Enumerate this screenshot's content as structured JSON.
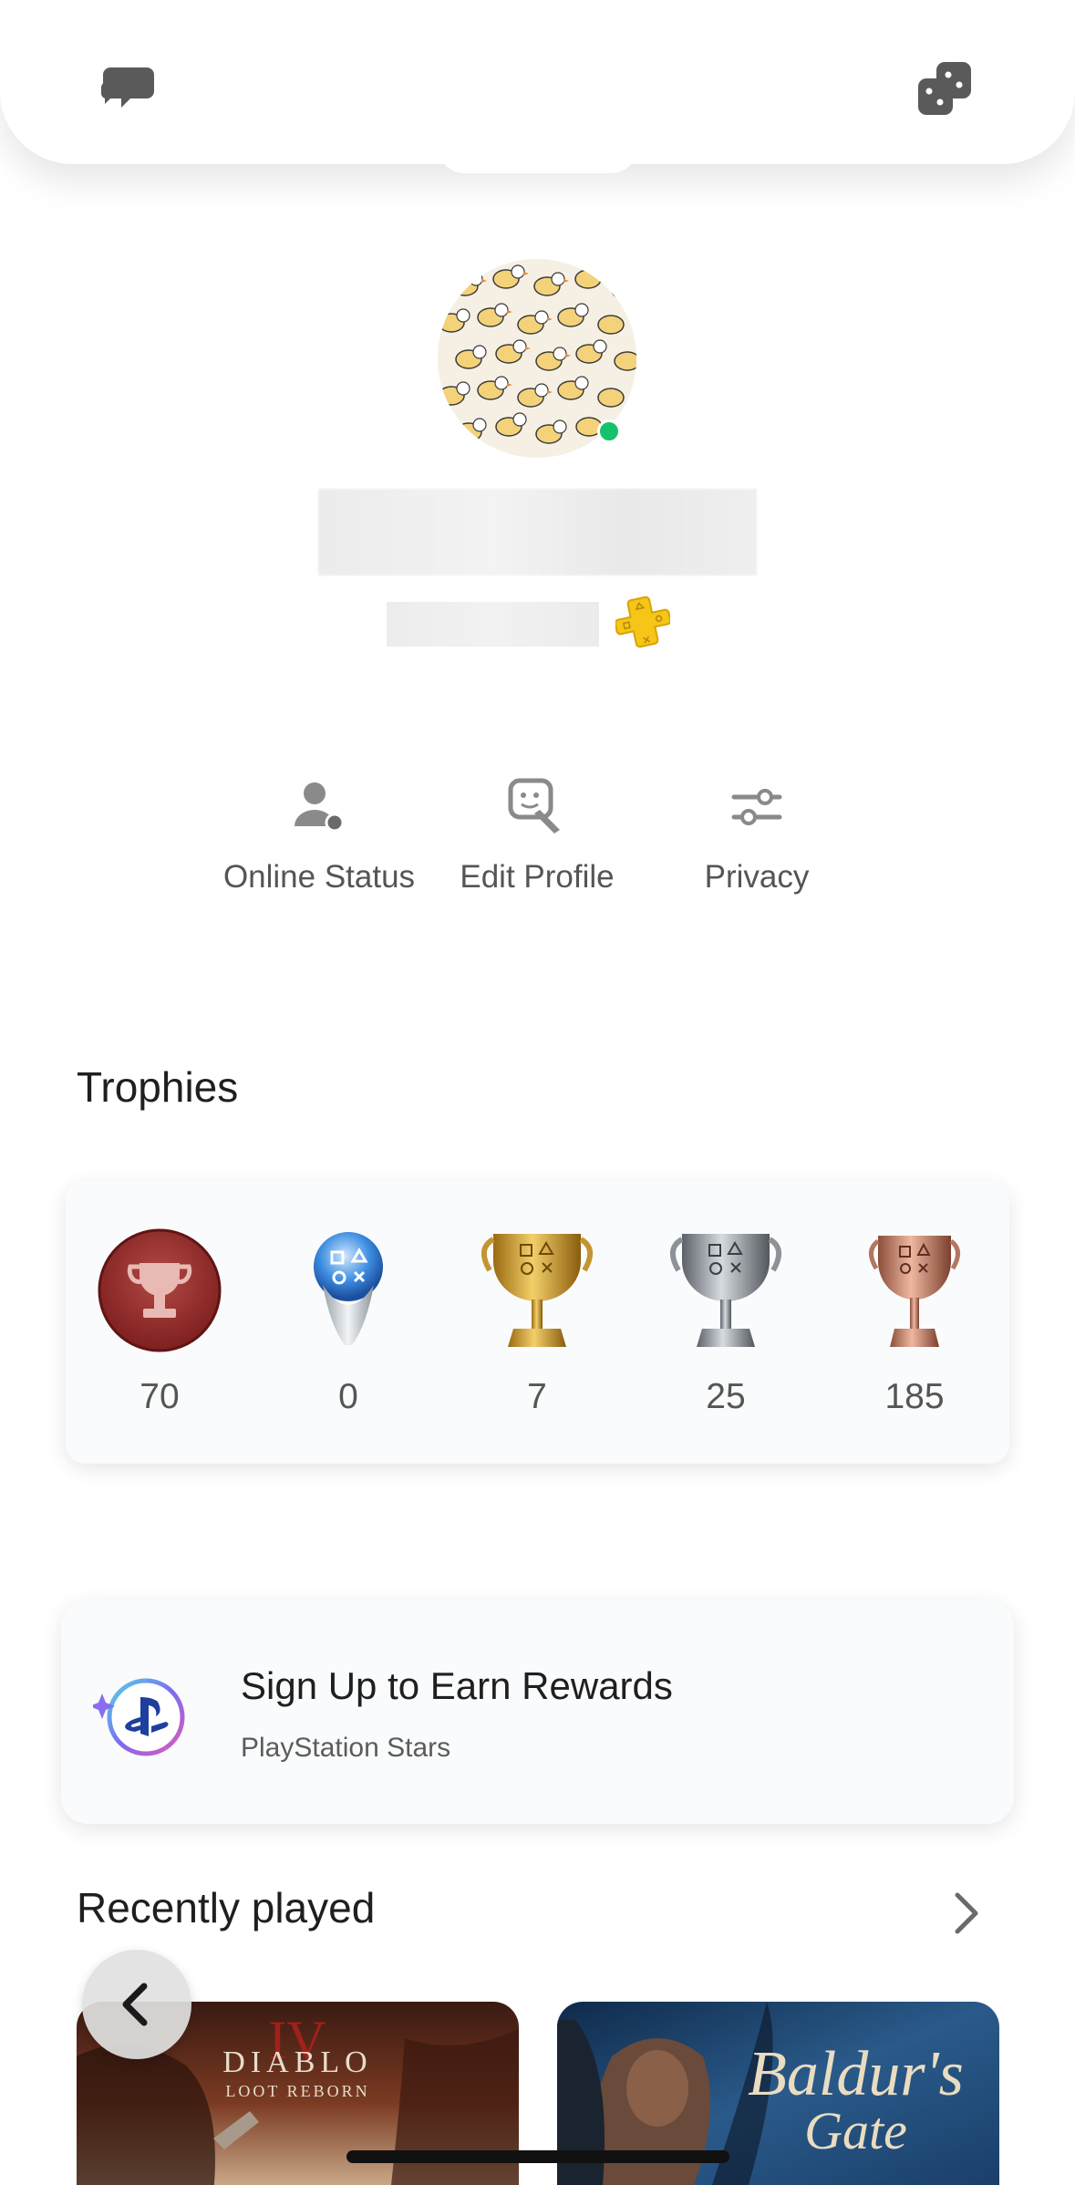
{
  "header": {
    "left_icon": "chat-bubbles-icon",
    "right_icon": "game-controller-icon"
  },
  "profile": {
    "online": true,
    "online_color": "#15c26b",
    "plus_badge_color": "#f5c518"
  },
  "actions": [
    {
      "label": "Online Status",
      "icon": "person-status-icon"
    },
    {
      "label": "Edit Profile",
      "icon": "edit-profile-icon"
    },
    {
      "label": "Privacy",
      "icon": "sliders-icon"
    }
  ],
  "trophies": {
    "title": "Trophies",
    "items": [
      {
        "kind": "level",
        "count": "70"
      },
      {
        "kind": "platinum",
        "count": "0"
      },
      {
        "kind": "gold",
        "count": "7"
      },
      {
        "kind": "silver",
        "count": "25"
      },
      {
        "kind": "bronze",
        "count": "185"
      }
    ]
  },
  "rewards": {
    "title": "Sign Up to Earn Rewards",
    "subtitle": "PlayStation Stars"
  },
  "recent": {
    "title": "Recently played",
    "games": [
      {
        "title": "DIABLO",
        "subtitle": "LOOT REBORN",
        "numeral": "IV"
      },
      {
        "title": "Baldur's",
        "subtitle": "Gate"
      }
    ]
  }
}
